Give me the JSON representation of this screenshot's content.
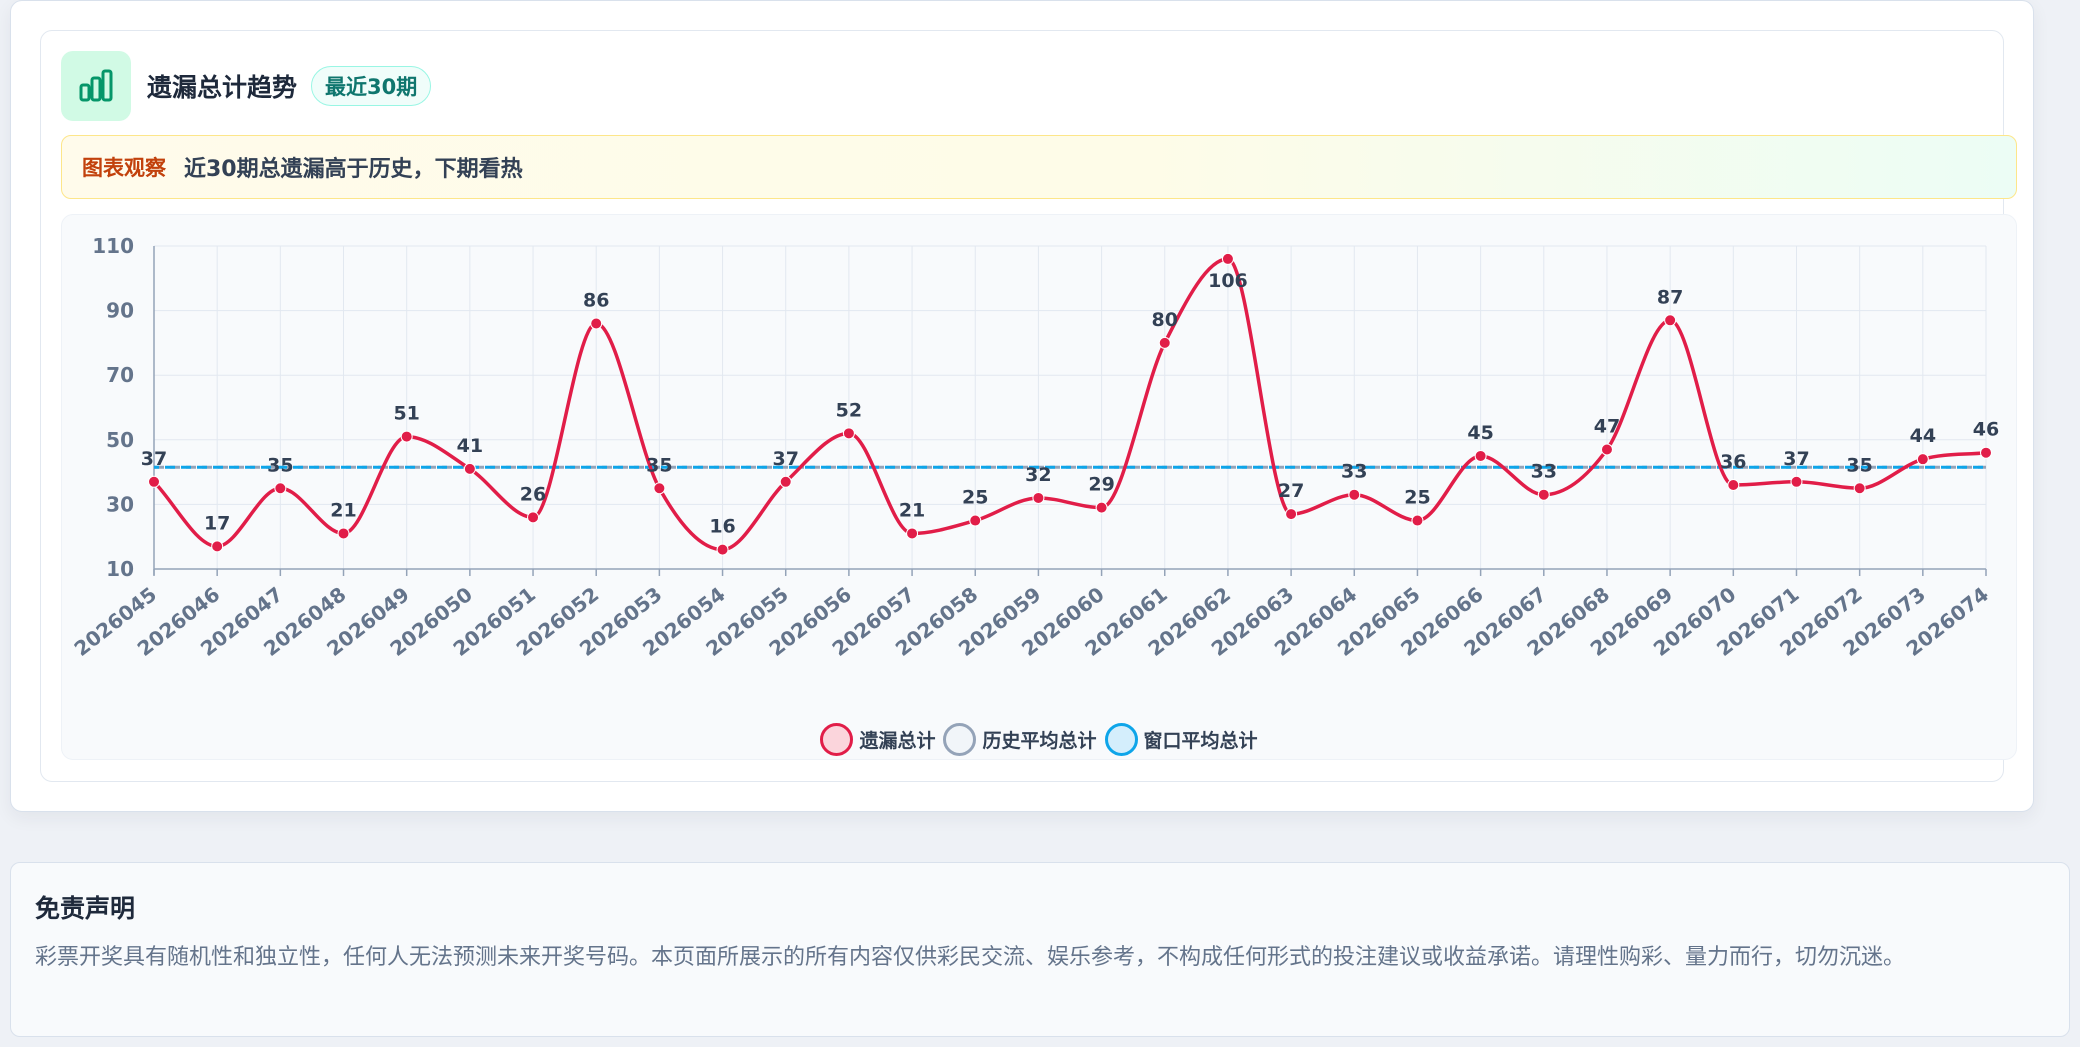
{
  "header": {
    "title": "遗漏总计趋势",
    "badge": "最近30期",
    "icon": "bar-chart-icon"
  },
  "observation": {
    "label": "图表观察",
    "text": "近30期总遗漏高于历史，下期看热"
  },
  "colors": {
    "series_main": "#e11d48",
    "series_main_fill": "#fbd5dc",
    "hist_avg": "#94a3b8",
    "window_avg": "#0ea5e9",
    "grid": "#e2e8f0",
    "tick": "#64748b",
    "label": "#334155",
    "icon": "#059669"
  },
  "chart_data": {
    "type": "line",
    "categories": [
      "2026045",
      "2026046",
      "2026047",
      "2026048",
      "2026049",
      "2026050",
      "2026051",
      "2026052",
      "2026053",
      "2026054",
      "2026055",
      "2026056",
      "2026057",
      "2026058",
      "2026059",
      "2026060",
      "2026061",
      "2026062",
      "2026063",
      "2026064",
      "2026065",
      "2026066",
      "2026067",
      "2026068",
      "2026069",
      "2026070",
      "2026071",
      "2026072",
      "2026073",
      "2026074"
    ],
    "series": [
      {
        "name": "遗漏总计",
        "values": [
          37,
          17,
          35,
          21,
          51,
          41,
          26,
          86,
          35,
          16,
          37,
          52,
          21,
          25,
          32,
          29,
          80,
          106,
          27,
          33,
          25,
          45,
          33,
          47,
          87,
          36,
          37,
          35,
          44,
          46
        ]
      },
      {
        "name": "历史平均总计",
        "constant": 41.5
      },
      {
        "name": "窗口平均总计",
        "constant": 41.5
      }
    ],
    "yticks": [
      10,
      30,
      50,
      70,
      90,
      110
    ],
    "ylim": [
      10,
      110
    ],
    "grid": true,
    "legend_position": "bottom-center",
    "data_labels": true
  },
  "legend": [
    {
      "label": "遗漏总计"
    },
    {
      "label": "历史平均总计"
    },
    {
      "label": "窗口平均总计"
    }
  ],
  "disclaimer": {
    "title": "免责声明",
    "text": "彩票开奖具有随机性和独立性，任何人无法预测未来开奖号码。本页面所展示的所有内容仅供彩民交流、娱乐参考，不构成任何形式的投注建议或收益承诺。请理性购彩、量力而行，切勿沉迷。"
  }
}
